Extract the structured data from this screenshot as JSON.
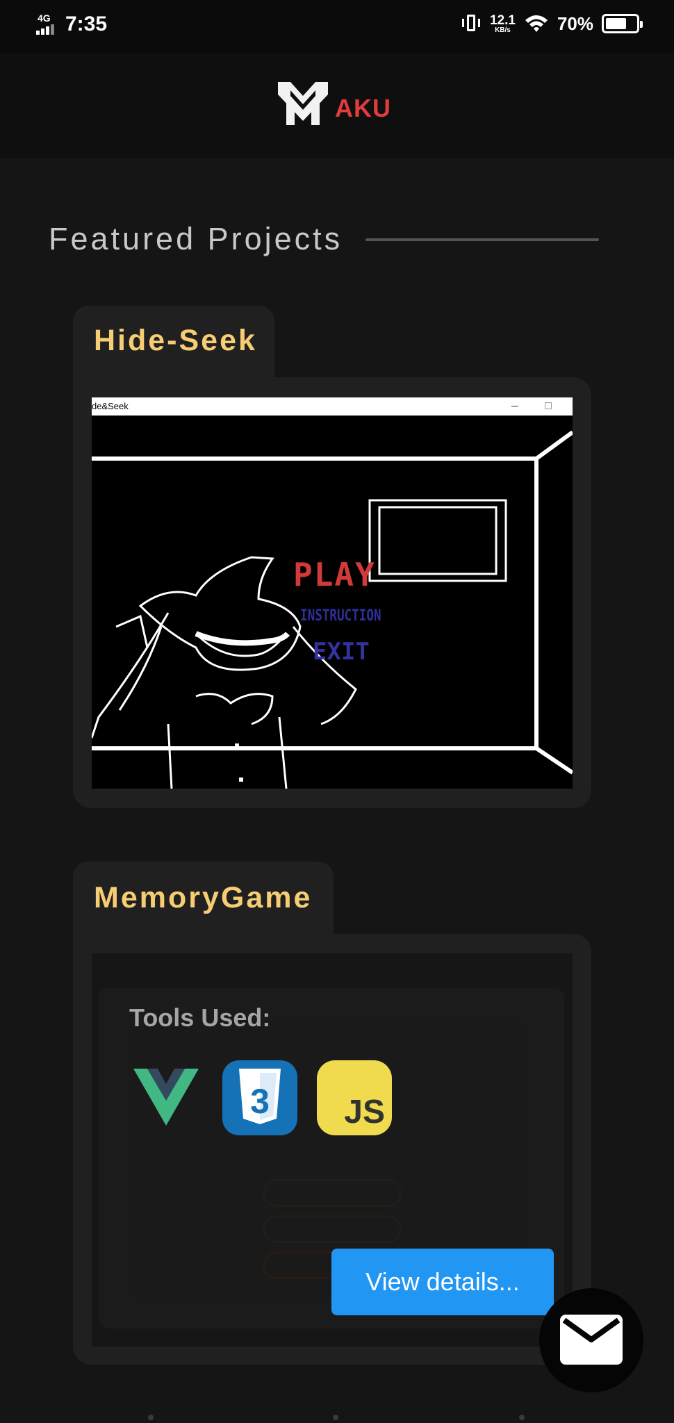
{
  "status_bar": {
    "network": "4G",
    "time": "7:35",
    "speed_value": "12.1",
    "speed_unit": "KB/s",
    "battery": "70%",
    "battery_level": 0.7,
    "icons": [
      "signal-icon",
      "vibrate-icon",
      "wifi-icon",
      "battery-icon"
    ]
  },
  "header": {
    "logo_text": "AKU",
    "logo_icon": "m-logo-icon",
    "logo_text_color": "#e23b3b"
  },
  "section": {
    "title": "Featured Projects"
  },
  "projects": [
    {
      "title": "Hide-Seek",
      "screenshot": {
        "window_title": "de&Seek",
        "menu": [
          "PLAY",
          "INSTRUCTION",
          "EXIT"
        ]
      }
    },
    {
      "title": "MemoryGame",
      "tools_label": "Tools Used:",
      "tools": [
        "vue-icon",
        "css3-icon",
        "javascript-icon"
      ],
      "js_text": "JS",
      "action_label": "View details..."
    }
  ],
  "fab": {
    "icon": "mail-icon"
  },
  "colors": {
    "accent_title": "#f6cd73",
    "button": "#2196f3",
    "card": "#202020",
    "background": "#151515"
  }
}
